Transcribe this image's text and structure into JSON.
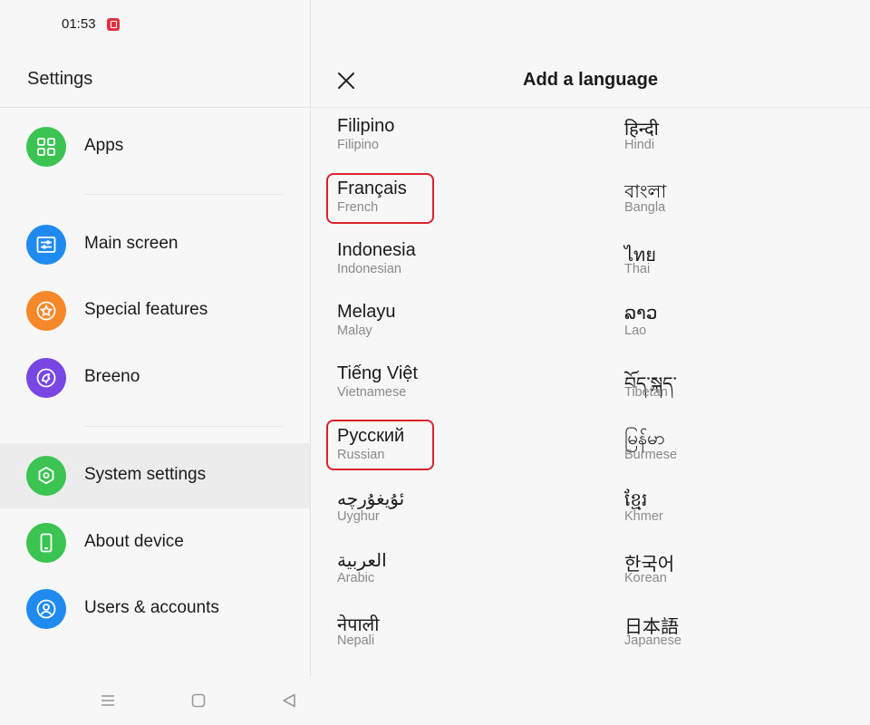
{
  "status_bar": {
    "time": "01:53",
    "notification_icon": "screen-record-icon"
  },
  "settings": {
    "title": "Settings",
    "items": [
      {
        "label": "Apps",
        "icon": "apps-grid-icon",
        "color": "#3cc453",
        "selected": false
      },
      {
        "label": "Main screen",
        "icon": "main-screen-icon",
        "color": "#1f8bf0",
        "selected": false
      },
      {
        "label": "Special features",
        "icon": "star-icon",
        "color": "#f6882a",
        "selected": false
      },
      {
        "label": "Breeno",
        "icon": "breeno-icon",
        "color": "#7a46e3",
        "selected": false
      },
      {
        "label": "System settings",
        "icon": "hexagon-settings-icon",
        "color": "#3cc453",
        "selected": true
      },
      {
        "label": "About device",
        "icon": "phone-icon",
        "color": "#3cc453",
        "selected": false
      },
      {
        "label": "Users & accounts",
        "icon": "user-account-icon",
        "color": "#1f8bf0",
        "selected": false
      }
    ]
  },
  "nav_bar": {
    "buttons": [
      "menu-icon",
      "home-icon",
      "back-icon"
    ]
  },
  "add_language": {
    "title": "Add a language",
    "close_icon": "close-icon",
    "highlight_color": "#d9222f",
    "left_column": [
      {
        "native": "Filipino",
        "english": "Filipino",
        "highlighted": false
      },
      {
        "native": "Français",
        "english": "French",
        "highlighted": true
      },
      {
        "native": "Indonesia",
        "english": "Indonesian",
        "highlighted": false
      },
      {
        "native": "Melayu",
        "english": "Malay",
        "highlighted": false
      },
      {
        "native": "Tiếng Việt",
        "english": "Vietnamese",
        "highlighted": false
      },
      {
        "native": "Русский",
        "english": "Russian",
        "highlighted": true
      },
      {
        "native": "ئۇيغۇرچە",
        "english": "Uyghur",
        "highlighted": false
      },
      {
        "native": "العربية",
        "english": "Arabic",
        "highlighted": false
      },
      {
        "native": "नेपाली",
        "english": "Nepali",
        "highlighted": false
      }
    ],
    "right_column": [
      {
        "native": "हिन्दी",
        "english": "Hindi",
        "highlighted": false
      },
      {
        "native": "বাংলা",
        "english": "Bangla",
        "highlighted": false
      },
      {
        "native": "ไทย",
        "english": "Thai",
        "highlighted": false
      },
      {
        "native": "ລາວ",
        "english": "Lao",
        "highlighted": false
      },
      {
        "native": "བོད་སྐད་",
        "english": "Tibetan",
        "highlighted": false
      },
      {
        "native": "မြန်မာ",
        "english": "Burmese",
        "highlighted": false
      },
      {
        "native": "ខ្មែរ",
        "english": "Khmer",
        "highlighted": false
      },
      {
        "native": "한국어",
        "english": "Korean",
        "highlighted": false
      },
      {
        "native": "日本語",
        "english": "Japanese",
        "highlighted": false
      }
    ]
  }
}
